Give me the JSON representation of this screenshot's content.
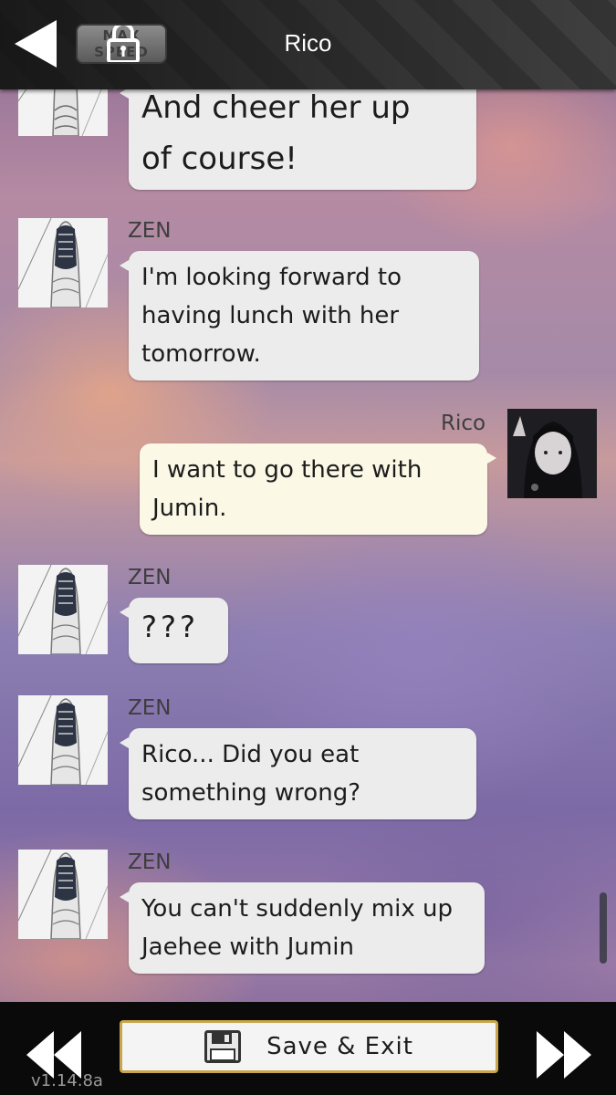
{
  "header": {
    "title": "Rico",
    "max_speed_label": "MAX\nSPEED"
  },
  "messages": [
    {
      "sender": "",
      "side": "left",
      "text": "And cheer her up\nof course!"
    },
    {
      "sender": "ZEN",
      "side": "left",
      "text": "I'm looking forward to\nhaving lunch with her\ntomorrow."
    },
    {
      "sender": "Rico",
      "side": "right",
      "text": "I want to go there with\nJumin."
    },
    {
      "sender": "ZEN",
      "side": "left",
      "text": "???"
    },
    {
      "sender": "ZEN",
      "side": "left",
      "text": "Rico... Did you eat\nsomething wrong?"
    },
    {
      "sender": "ZEN",
      "side": "left",
      "text": "You can't suddenly mix up\nJaehee with Jumin"
    }
  ],
  "footer": {
    "save_exit_label": "Save & Exit",
    "version": "v1.14.8a"
  },
  "colors": {
    "header_bg": "#2a2a2a",
    "bubble_other": "#ececec",
    "bubble_self": "#fbf8e6",
    "save_border": "#c9a64c",
    "footer_bg": "#0a0a0a"
  },
  "icons": [
    "back-arrow-icon",
    "lock-icon",
    "save-disk-icon",
    "rewind-icon",
    "fast-forward-icon"
  ]
}
